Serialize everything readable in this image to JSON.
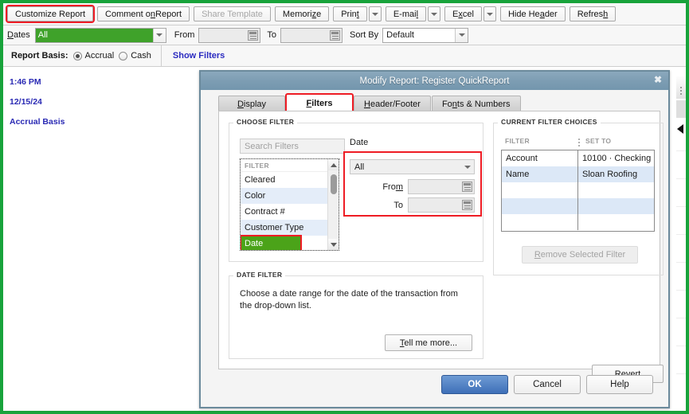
{
  "window": {
    "frame_color": "#18a33b"
  },
  "toolbar": {
    "buttons": [
      {
        "label": "Customize Report",
        "name": "customize-report-button",
        "disabled": false,
        "highlight": true
      },
      {
        "label": "Comment on Report",
        "name": "comment-on-report-button",
        "disabled": false,
        "highlight": false
      },
      {
        "label": "Share Template",
        "name": "share-template-button",
        "disabled": true,
        "highlight": false
      },
      {
        "label": "Memorize",
        "name": "memorize-button",
        "disabled": false,
        "highlight": false
      }
    ],
    "print_label": "Print",
    "email_label": "E-mail",
    "excel_label": "Excel",
    "hide_header_label": "Hide Header",
    "refresh_label": "Refresh"
  },
  "datesbar": {
    "dates_label": "Dates",
    "dates_value": "All",
    "from_label": "From",
    "from_value": "",
    "to_label": "To",
    "to_value": "",
    "sortby_label": "Sort By",
    "sortby_value": "Default"
  },
  "basisbar": {
    "report_basis_label": "Report Basis:",
    "accrual_label": "Accrual",
    "cash_label": "Cash",
    "selected": "Accrual",
    "show_filters_label": "Show Filters",
    "show_filters_color": "#2b2bc0"
  },
  "report": {
    "time": "1:46 PM",
    "date": "12/15/24",
    "basis": "Accrual Basis"
  },
  "dialog": {
    "title": "Modify Report: Register QuickReport",
    "close_icon": "✖",
    "tabs": [
      {
        "label": "Display",
        "name": "tab-display",
        "active": false,
        "highlight": false
      },
      {
        "label": "Filters",
        "name": "tab-filters",
        "active": true,
        "highlight": true
      },
      {
        "label": "Header/Footer",
        "name": "tab-header-footer",
        "active": false,
        "highlight": false
      },
      {
        "label": "Fonts & Numbers",
        "name": "tab-fonts-numbers",
        "active": false,
        "highlight": false
      }
    ],
    "choose_filter": {
      "group_title": "CHOOSE FILTER",
      "search_placeholder": "Search Filters",
      "search_value": "",
      "list_header": "FILTER",
      "items": [
        {
          "label": "Cleared",
          "selected": false
        },
        {
          "label": "Color",
          "selected": false
        },
        {
          "label": "Contract #",
          "selected": false
        },
        {
          "label": "Customer Type",
          "selected": false
        },
        {
          "label": "Date",
          "selected": true
        }
      ],
      "selected_filter_name": "Date",
      "value_dropdown": "All",
      "from_label": "From",
      "from_value": "",
      "to_label": "To",
      "to_value": ""
    },
    "current_filter_choices": {
      "group_title": "CURRENT FILTER CHOICES",
      "columns": [
        "FILTER",
        "SET TO"
      ],
      "rows": [
        {
          "filter": "Account",
          "set_to": "10100 · Checking"
        },
        {
          "filter": "Name",
          "set_to": "Sloan Roofing"
        },
        {
          "filter": "",
          "set_to": ""
        },
        {
          "filter": "",
          "set_to": ""
        },
        {
          "filter": "",
          "set_to": ""
        }
      ],
      "remove_button_label": "Remove Selected Filter",
      "remove_button_disabled": true
    },
    "date_filter": {
      "group_title": "DATE FILTER",
      "description": "Choose a date range for the date of the transaction from the drop-down list.",
      "tell_me_more_label": "Tell me more..."
    },
    "revert_label": "Revert",
    "footer": {
      "ok_label": "OK",
      "cancel_label": "Cancel",
      "help_label": "Help",
      "ok_color": "#3e6fb8"
    }
  },
  "annotations": {
    "highlight_color": "#ee1c24",
    "boxes": [
      "customize-report-button",
      "tab-filters",
      "filter-list-date-row",
      "date-value-controls"
    ]
  }
}
